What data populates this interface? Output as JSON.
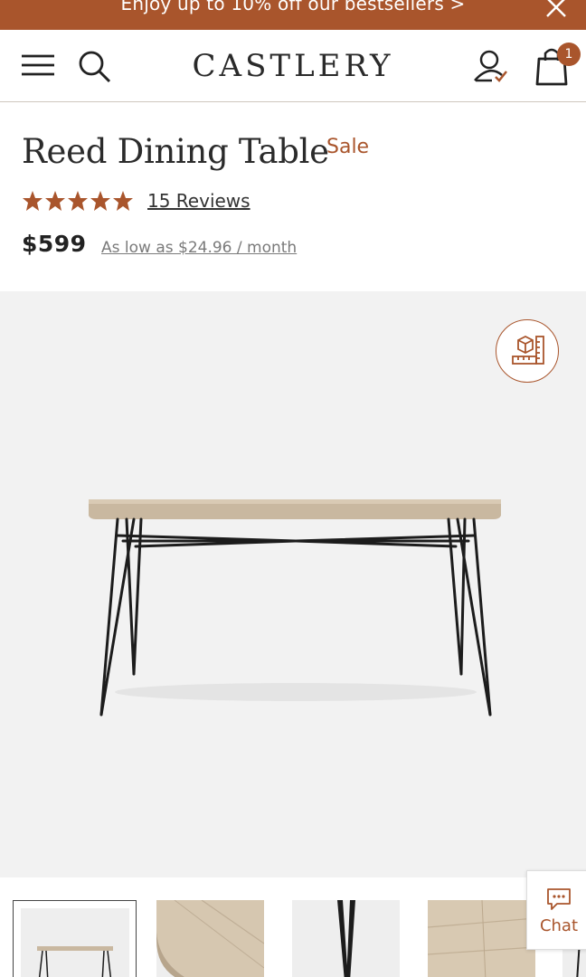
{
  "promo": {
    "text": "Enjoy up to 10% off our bestsellers >",
    "close_icon": "close-icon"
  },
  "header": {
    "logo": "CASTLERY",
    "cart_count": "1",
    "icons": [
      "menu-icon",
      "search-icon",
      "account-icon",
      "cart-icon"
    ]
  },
  "product": {
    "title": "Reed Dining Table",
    "sale_label": "Sale",
    "rating_stars": 5,
    "reviews_label": "15 Reviews",
    "price": "$599",
    "installment_label": "As low as $24.96  / month"
  },
  "gallery": {
    "ar_button_icon": "ar-view-icon",
    "thumbnails": [
      "thumbnail-table-front",
      "thumbnail-tabletop-corner",
      "thumbnail-hairpin-leg",
      "thumbnail-wood-detail",
      "thumbnail-leg-edge"
    ]
  },
  "chat": {
    "label": "Chat",
    "icon": "chat-bubble-icon"
  },
  "colors": {
    "accent": "#a9552c",
    "gallery_bg": "#f2f2f2",
    "text": "#222222"
  }
}
